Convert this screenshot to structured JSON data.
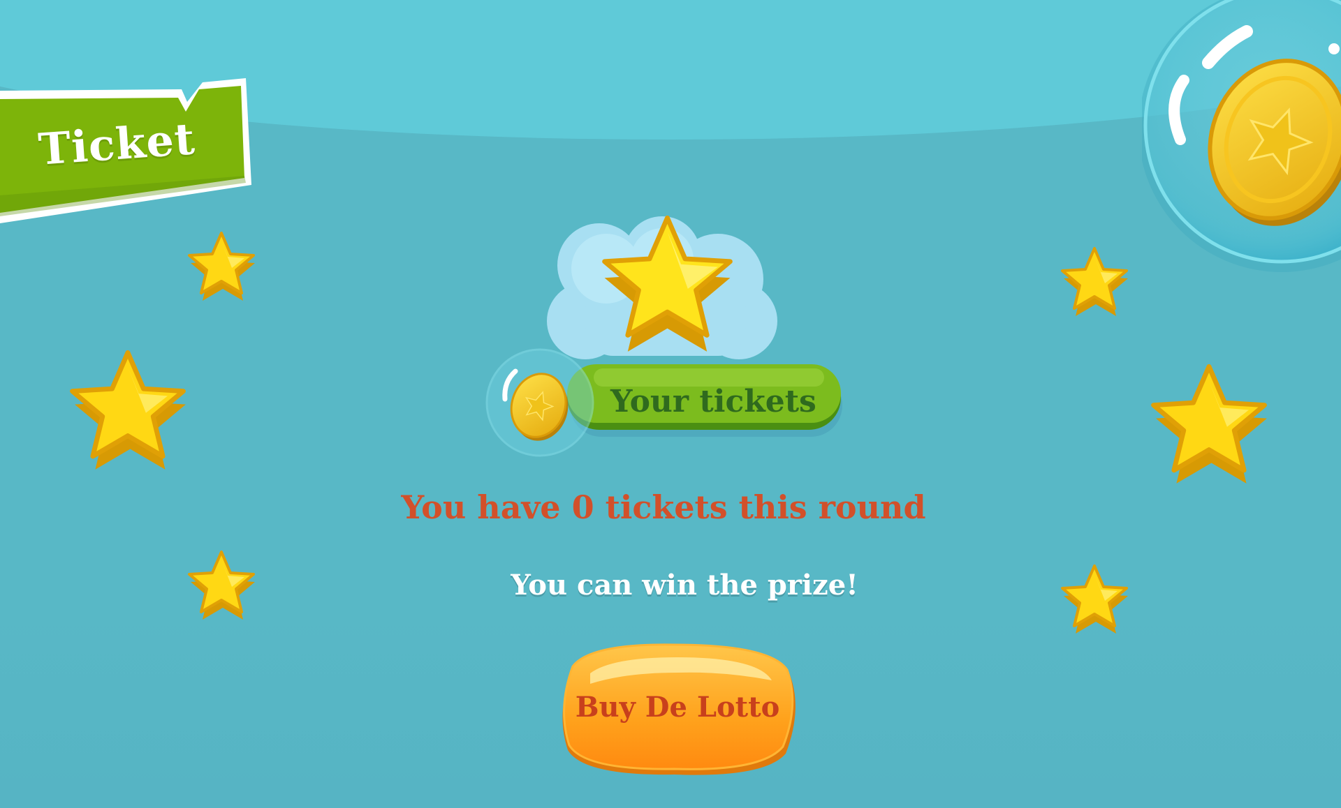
{
  "header": {
    "tab_label": "Ticket"
  },
  "tickets": {
    "pill_label": "Your tickets",
    "count_message": "You have 0 tickets this round",
    "prize_message": "You can win the prize!"
  },
  "actions": {
    "buy_label": "Buy De Lotto"
  },
  "colors": {
    "background": "#58b8c6",
    "ribbon_green": "#7db40a",
    "pill_green": "#7cbc1e",
    "pill_text": "#2f6a1e",
    "message_red": "#d2502a",
    "button_orange": "#ff9f1a",
    "star_yellow": "#ffd814"
  },
  "icons": {
    "decor_star": "star-icon",
    "coin": "coin-icon",
    "bubble": "bubble-icon"
  }
}
